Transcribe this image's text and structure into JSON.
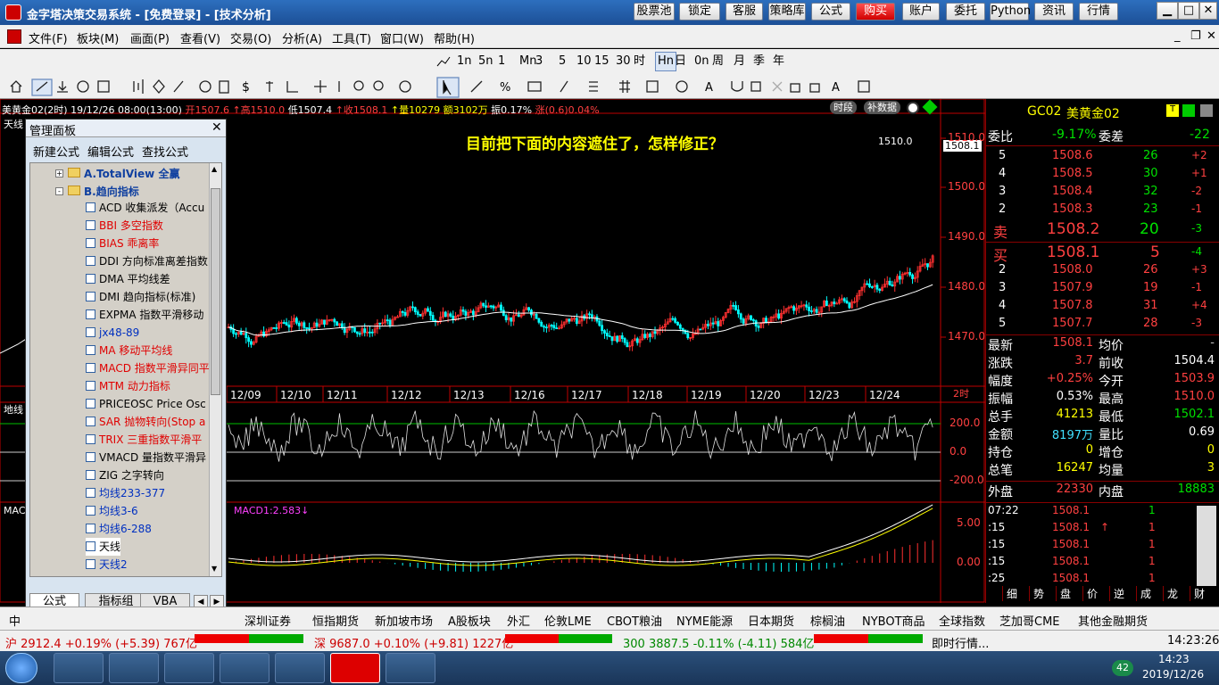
{
  "title": {
    "text": "金字塔决策交易系统 - [免费登录] - [技术分析]"
  },
  "title_buttons": [
    "股票池",
    "锁定",
    "客服",
    "策略库",
    "公式",
    "购买",
    "账户",
    "委托",
    "Python",
    "资讯",
    "行情"
  ],
  "menu": [
    "文件(F)",
    "板块(M)",
    "画面(P)",
    "查看(V)",
    "交易(O)",
    "分析(A)",
    "工具(T)",
    "窗口(W)",
    "帮助(H)"
  ],
  "periods": [
    "1m",
    "5m",
    "15",
    "30",
    "1h",
    "4h",
    "日",
    "周",
    "月",
    "季",
    "年"
  ],
  "period_labels": [
    "1n",
    "5n",
    "1",
    "Mn",
    "3",
    "5",
    "10",
    "15",
    "30",
    "时",
    "Hn",
    "日",
    "0n",
    "周",
    "月",
    "季",
    "年"
  ],
  "chart_info": "美黄金02(2时) 19/12/26 08:00(13:00) 开1507.6 高1510.0 低1507.4 收1508.1 量10279 额3102万 振0.17% 涨(0.6)0.04%",
  "chart_info_parts": {
    "name": "美黄金02(2时) 19/12/26 08:00(13:00)",
    "open": "开1507.6",
    "high": "↑高1510.0",
    "low": "低1507.4",
    "close": "↑收1508.1",
    "vol": "↑量10279",
    "amount": "额3102万",
    "amp": "振0.17%",
    "chg": "涨(0.6)0.04%"
  },
  "chart_buttons": [
    "时段",
    "补数据"
  ],
  "annotation": "目前把下面的内容遮住了，怎样修正？",
  "price_label_top": "1510.0",
  "price_tag": "1508.1",
  "y_ticks": [
    "1510.0",
    "1500.0",
    "1490.0",
    "1480.0",
    "1470.0"
  ],
  "dates": [
    "12/09",
    "12/10",
    "12/11",
    "12/12",
    "12/13",
    "12/16",
    "12/17",
    "12/18",
    "12/19",
    "12/20",
    "12/23",
    "12/24"
  ],
  "period_tag": "2时",
  "ind1": {
    "name": "地线",
    "ticks": [
      "200.0",
      "0.0",
      "-200.0"
    ]
  },
  "ind2": {
    "name": "MACD",
    "label": "MACD1:2.583↓",
    "ticks": [
      "5.00",
      "0.00"
    ]
  },
  "quote": {
    "code": "GC02",
    "name": "美黄金02",
    "weibi_label": "委比",
    "weibi": "-9.17%",
    "weicha_label": "委差",
    "weicha": "-22",
    "asks": [
      [
        "5",
        "1508.6",
        "26",
        "+2"
      ],
      [
        "4",
        "1508.5",
        "30",
        "+1"
      ],
      [
        "3",
        "1508.4",
        "32",
        "-2"
      ],
      [
        "2",
        "1508.3",
        "23",
        "-1"
      ]
    ],
    "sell_label": "卖",
    "sell": [
      "1508.2",
      "20",
      "-3"
    ],
    "buy_label": "买",
    "buy": [
      "1508.1",
      "5",
      "-4"
    ],
    "bids": [
      [
        "2",
        "1508.0",
        "26",
        "+3"
      ],
      [
        "3",
        "1507.9",
        "19",
        "-1"
      ],
      [
        "4",
        "1507.8",
        "31",
        "+4"
      ],
      [
        "5",
        "1507.7",
        "28",
        "-3"
      ]
    ],
    "stats": [
      [
        "最新",
        "1508.1",
        "均价",
        "-"
      ],
      [
        "涨跌",
        "3.7",
        "前收",
        "1504.4"
      ],
      [
        "幅度",
        "+0.25%",
        "今开",
        "1503.9"
      ],
      [
        "振幅",
        "0.53%",
        "最高",
        "1510.0"
      ],
      [
        "总手",
        "41213",
        "最低",
        "1502.1"
      ],
      [
        "金额",
        "8197万",
        "量比",
        "0.69"
      ],
      [
        "持仓",
        "0",
        "增仓",
        "0"
      ],
      [
        "总笔",
        "16247",
        "均量",
        "3"
      ]
    ],
    "waipan_label": "外盘",
    "waipan": "22330",
    "neipan_label": "内盘",
    "neipan": "18883",
    "ticks": [
      [
        "07:22",
        "1508.1",
        "",
        "1"
      ],
      [
        ":15",
        "1508.1",
        "↑",
        "1"
      ],
      [
        ":15",
        "1508.1",
        "",
        "1"
      ],
      [
        ":15",
        "1508.1",
        "",
        "1"
      ],
      [
        ":25",
        "1508.1",
        "",
        "1"
      ]
    ],
    "tabs": [
      "细",
      "势",
      "盘",
      "价",
      "逆",
      "成",
      "龙",
      "财"
    ]
  },
  "panel": {
    "title": "管理面板",
    "actions": [
      "新建公式",
      "编辑公式",
      "查找公式"
    ],
    "folders": [
      "A.TotalView 全赢",
      "B.趋向指标"
    ],
    "items": [
      {
        "t": "ACD 收集派发（Accu",
        "c": "#000"
      },
      {
        "t": "BBI 多空指数",
        "c": "#e00000"
      },
      {
        "t": "BIAS 乖离率",
        "c": "#e00000"
      },
      {
        "t": "DDI 方向标准离差指数",
        "c": "#000"
      },
      {
        "t": "DMA 平均线差",
        "c": "#000"
      },
      {
        "t": "DMI 趋向指标(标准)",
        "c": "#000"
      },
      {
        "t": "EXPMA 指数平滑移动",
        "c": "#000"
      },
      {
        "t": "jx48-89",
        "c": "#0030c0"
      },
      {
        "t": "MA 移动平均线",
        "c": "#e00000"
      },
      {
        "t": "MACD 指数平滑异同平",
        "c": "#e00000"
      },
      {
        "t": "MTM 动力指标",
        "c": "#e00000"
      },
      {
        "t": "PRICEOSC Price Osc",
        "c": "#000"
      },
      {
        "t": "SAR 抛物转向(Stop a",
        "c": "#e00000"
      },
      {
        "t": "TRIX 三重指数平滑平",
        "c": "#e00000"
      },
      {
        "t": "VMACD 量指数平滑异",
        "c": "#000"
      },
      {
        "t": "ZIG 之字转向",
        "c": "#000"
      },
      {
        "t": "均线233-377",
        "c": "#0030c0"
      },
      {
        "t": "均线3-6",
        "c": "#0030c0"
      },
      {
        "t": "均线6-288",
        "c": "#0030c0"
      },
      {
        "t": "天线",
        "c": "#000"
      },
      {
        "t": "天线2",
        "c": "#0030c0"
      }
    ],
    "tabs": [
      "公式",
      "指标组",
      "VBA"
    ]
  },
  "markets": [
    "中",
    "深圳证券",
    "恒指期货",
    "新加坡市场",
    "A股板块",
    "外汇",
    "伦敦LME",
    "CBOT粮油",
    "NYME能源",
    "日本期货",
    "棕榈油",
    "NYBOT商品",
    "全球指数",
    "芝加哥CME",
    "其他金融期货"
  ],
  "status": {
    "sh": "沪 2912.4 +0.19% (+5.39) 767亿",
    "sz": "深 9687.0 +0.10% (+9.81) 1227亿",
    "s300": "300 3887.5 -0.11% (-4.11) 584亿",
    "news": "即时行情...",
    "time": "14:23:26"
  },
  "taskbar": {
    "time": "14:23",
    "date": "2019/12/26",
    "badge": "42"
  },
  "colors": {
    "up": "#ff3030",
    "down": "#00ffff",
    "ma": "#ffffff",
    "axis": "#c00000"
  }
}
